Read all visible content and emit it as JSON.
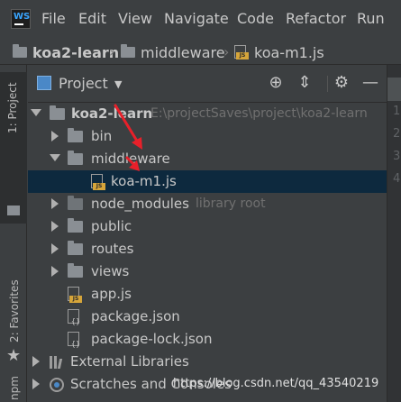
{
  "app": {
    "logo_text": "WS"
  },
  "menu": [
    "File",
    "Edit",
    "View",
    "Navigate",
    "Code",
    "Refactor",
    "Run"
  ],
  "breadcrumb": {
    "project": "koa2-learn",
    "folder": "middleware",
    "file": "koa-m1.js"
  },
  "side_tabs": {
    "project": "1: Project",
    "favorites": "2: Favorites",
    "npm": "npm"
  },
  "tool_window": {
    "title": "Project"
  },
  "tree": {
    "root": {
      "label": "koa2-learn",
      "path": "E:\\projectSaves\\project\\koa2-learn"
    },
    "bin": "bin",
    "middleware": "middleware",
    "selected_file": "koa-m1.js",
    "node_modules": {
      "label": "node_modules",
      "hint": "library root"
    },
    "public": "public",
    "routes": "routes",
    "views": "views",
    "app_js": "app.js",
    "package_json": "package.json",
    "package_lock": "package-lock.json",
    "external_libraries": "External Libraries",
    "scratches": "Scratches and Consoles"
  },
  "editor": {
    "line_numbers": [
      "1",
      "2",
      "3",
      "4"
    ]
  },
  "watermark": "https://blog.csdn.net/qq_43540219",
  "colors": {
    "selection": "#0d293e",
    "annotation_arrow": "#e8202a",
    "js_badge": "#d6a53a"
  }
}
